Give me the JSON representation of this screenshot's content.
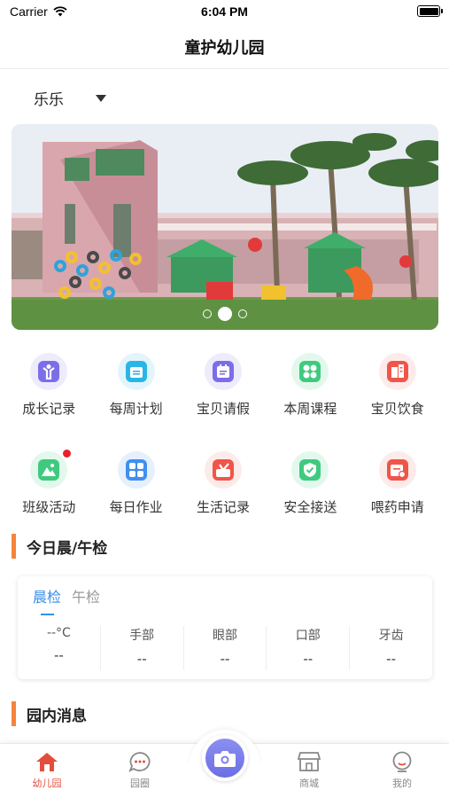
{
  "status_bar": {
    "carrier": "Carrier",
    "time": "6:04 PM"
  },
  "nav": {
    "title": "童护幼儿园"
  },
  "child_selector": {
    "name": "乐乐"
  },
  "banner": {
    "slide_count": 3,
    "active_slide": 2
  },
  "grid": {
    "items": [
      {
        "label": "成长记录",
        "icon": "growth-record-icon",
        "color": "#7c6ee8",
        "bg": "#eeebfd"
      },
      {
        "label": "每周计划",
        "icon": "weekly-plan-icon",
        "color": "#29b6e6",
        "bg": "#e3f5fc"
      },
      {
        "label": "宝贝请假",
        "icon": "leave-request-icon",
        "color": "#7c6ee8",
        "bg": "#eeebfd"
      },
      {
        "label": "本周课程",
        "icon": "weekly-course-icon",
        "color": "#3fca7f",
        "bg": "#e3f8ec"
      },
      {
        "label": "宝贝饮食",
        "icon": "diet-icon",
        "color": "#f0554a",
        "bg": "#fdebe9"
      },
      {
        "label": "班级活动",
        "icon": "class-activity-icon",
        "color": "#3fca7f",
        "bg": "#e3f8ec",
        "badge": true
      },
      {
        "label": "每日作业",
        "icon": "daily-homework-icon",
        "color": "#3f8ff0",
        "bg": "#e6f0fd"
      },
      {
        "label": "生活记录",
        "icon": "life-record-icon",
        "color": "#f0554a",
        "bg": "#fdebe9"
      },
      {
        "label": "安全接送",
        "icon": "safe-pickup-icon",
        "color": "#3fca7f",
        "bg": "#e3f8ec"
      },
      {
        "label": "喂药申请",
        "icon": "medicine-request-icon",
        "color": "#f0554a",
        "bg": "#fdebe9"
      }
    ]
  },
  "sections": {
    "health_check": {
      "title": "今日晨/午检"
    },
    "news": {
      "title": "园内消息"
    }
  },
  "check_card": {
    "tabs": [
      {
        "label": "晨检"
      },
      {
        "label": "午检"
      }
    ],
    "columns": [
      {
        "label": "--°C",
        "value": "--"
      },
      {
        "label": "手部",
        "value": "--"
      },
      {
        "label": "眼部",
        "value": "--"
      },
      {
        "label": "口部",
        "value": "--"
      },
      {
        "label": "牙齿",
        "value": "--"
      }
    ]
  },
  "tab_bar": {
    "items": [
      {
        "label": "幼儿园",
        "icon": "home-icon"
      },
      {
        "label": "园圈",
        "icon": "chat-icon"
      },
      {
        "label": "商城",
        "icon": "shop-icon"
      },
      {
        "label": "我的",
        "icon": "profile-icon"
      }
    ],
    "active_color": "#e34e3c",
    "camera_icon": "camera-icon"
  }
}
